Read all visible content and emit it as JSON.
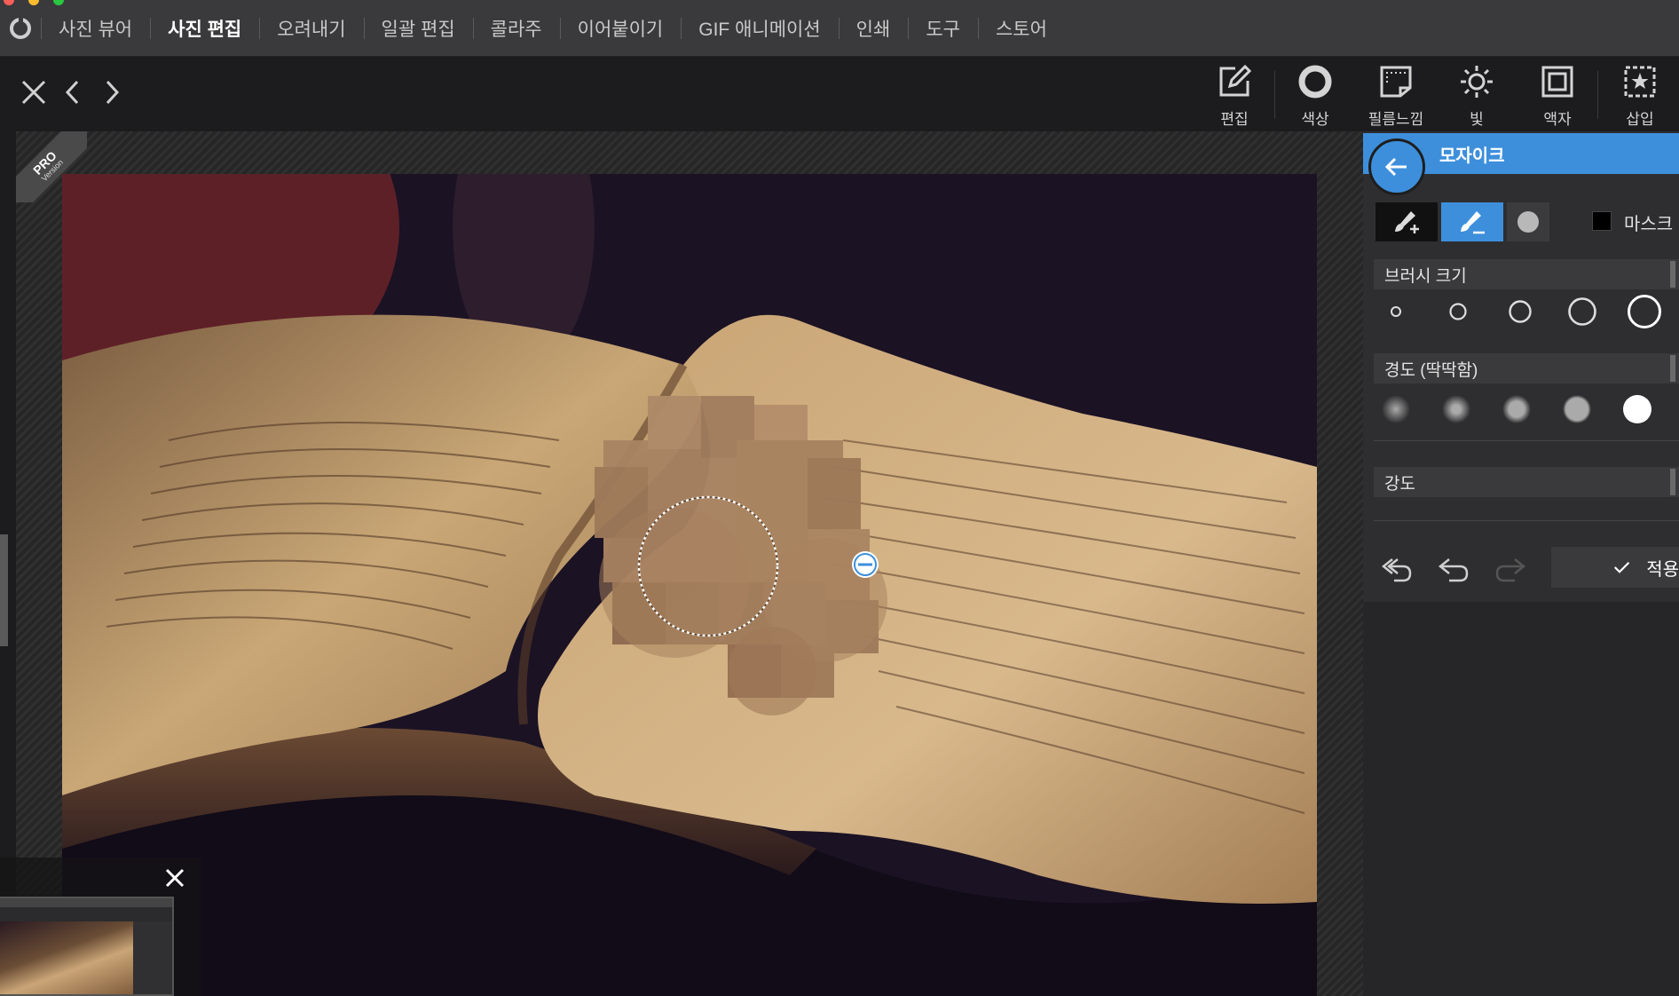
{
  "menubar": {
    "items": [
      {
        "label": "사진 뷰어"
      },
      {
        "label": "사진 편집",
        "active": true
      },
      {
        "label": "오려내기"
      },
      {
        "label": "일괄 편집"
      },
      {
        "label": "콜라주"
      },
      {
        "label": "이어붙이기"
      },
      {
        "label": "GIF 애니메이션"
      },
      {
        "label": "인쇄"
      },
      {
        "label": "도구"
      },
      {
        "label": "스토어"
      }
    ]
  },
  "toolbar": {
    "tools": [
      {
        "label": "편집",
        "icon": "edit-icon"
      },
      {
        "label": "색상",
        "icon": "color-circle-icon"
      },
      {
        "label": "필름느낌",
        "icon": "film-icon"
      },
      {
        "label": "빛",
        "icon": "sun-icon"
      },
      {
        "label": "액자",
        "icon": "frame-icon"
      },
      {
        "label": "삽입",
        "icon": "insert-star-icon"
      }
    ]
  },
  "badge": {
    "pro": "PRO",
    "version": "Version"
  },
  "panel": {
    "title": "모자이크",
    "mask_label": "마스크",
    "brush_size_label": "브러시 크기",
    "hardness_label": "경도 (딱딱함)",
    "strength_label": "강도",
    "apply_label": "적용",
    "accent_color": "#3d8fdc",
    "selected_brush_size_index": 4,
    "selected_hardness_index": 4
  }
}
